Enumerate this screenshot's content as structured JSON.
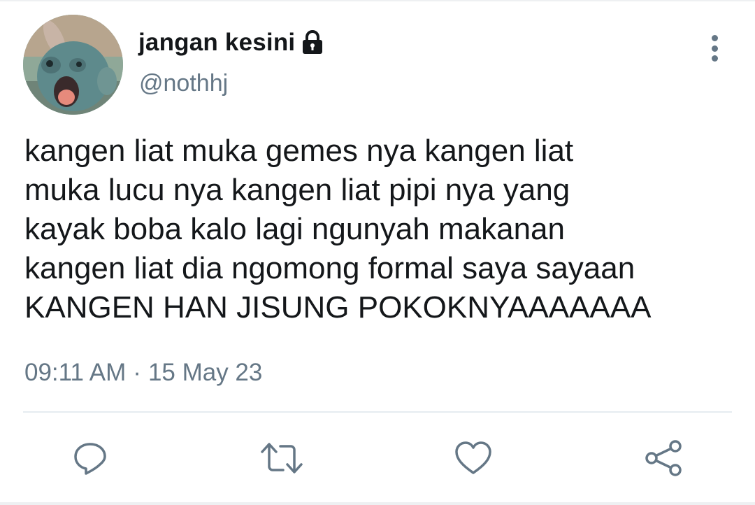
{
  "tweet": {
    "display_name": "jangan kesini",
    "handle": "@nothhj",
    "protected_icon": "lock-icon",
    "text": "kangen liat muka gemes nya kangen liat\nmuka lucu nya kangen liat pipi nya yang\nkayak boba kalo lagi ngunyah makanan\nkangen liat dia ngomong formal saya sayaan\nKANGEN HAN JISUNG POKOKNYAAAAAAA",
    "time": "09:11 AM",
    "separator": "·",
    "date": "15 May 23"
  },
  "actions": [
    {
      "icon": "reply-icon"
    },
    {
      "icon": "retweet-icon"
    },
    {
      "icon": "like-icon"
    },
    {
      "icon": "share-icon"
    }
  ],
  "colors": {
    "text_primary": "#14171a",
    "text_secondary": "#657786",
    "divider": "#e6ecf0"
  }
}
